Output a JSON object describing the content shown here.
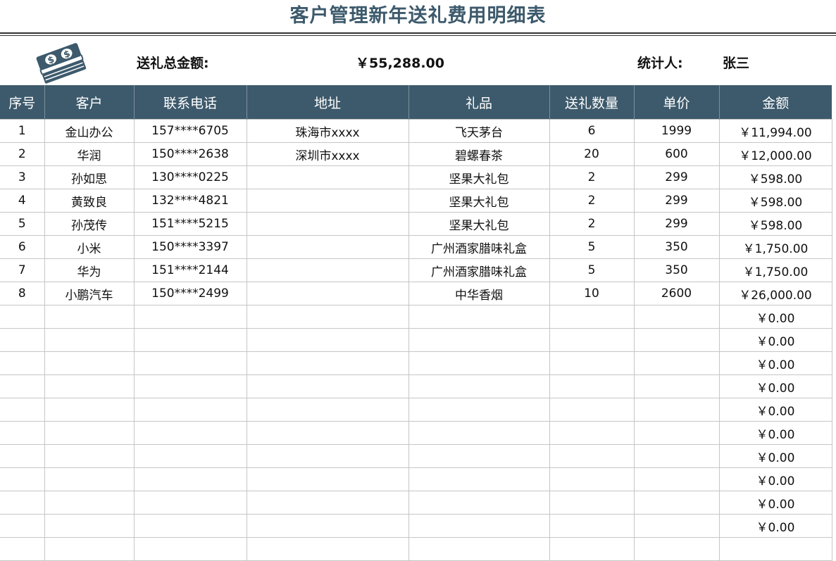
{
  "title": "客户管理新年送礼费用明细表",
  "summary": {
    "logo_icon": "money-stack-icon",
    "total_label": "送礼总金额:",
    "total_value": "￥55,288.00",
    "stat_label": "统计人:",
    "stat_value": "张三"
  },
  "colors": {
    "title": "#3d5a6c",
    "header_bg": "#3d5a6c",
    "header_text": "#ffffff",
    "grid": "#c6c6c6"
  },
  "table": {
    "headers": [
      "序号",
      "客户",
      "联系电话",
      "地址",
      "礼品",
      "送礼数量",
      "单价",
      "金额"
    ],
    "rows": [
      [
        "1",
        "金山办公",
        "157****6705",
        "珠海市xxxx",
        "飞天茅台",
        "6",
        "1999",
        "￥11,994.00"
      ],
      [
        "2",
        "华润",
        "150****2638",
        "深圳市xxxx",
        "碧螺春茶",
        "20",
        "600",
        "￥12,000.00"
      ],
      [
        "3",
        "孙如思",
        "130****0225",
        "",
        "坚果大礼包",
        "2",
        "299",
        "￥598.00"
      ],
      [
        "4",
        "黄致良",
        "132****4821",
        "",
        "坚果大礼包",
        "2",
        "299",
        "￥598.00"
      ],
      [
        "5",
        "孙茂传",
        "151****5215",
        "",
        "坚果大礼包",
        "2",
        "299",
        "￥598.00"
      ],
      [
        "6",
        "小米",
        "150****3397",
        "",
        "广州酒家腊味礼盒",
        "5",
        "350",
        "￥1,750.00"
      ],
      [
        "7",
        "华为",
        "151****2144",
        "",
        "广州酒家腊味礼盒",
        "5",
        "350",
        "￥1,750.00"
      ],
      [
        "8",
        "小鹏汽车",
        "150****2499",
        "",
        "中华香烟",
        "10",
        "2600",
        "￥26,000.00"
      ],
      [
        "",
        "",
        "",
        "",
        "",
        "",
        "",
        "￥0.00"
      ],
      [
        "",
        "",
        "",
        "",
        "",
        "",
        "",
        "￥0.00"
      ],
      [
        "",
        "",
        "",
        "",
        "",
        "",
        "",
        "￥0.00"
      ],
      [
        "",
        "",
        "",
        "",
        "",
        "",
        "",
        "￥0.00"
      ],
      [
        "",
        "",
        "",
        "",
        "",
        "",
        "",
        "￥0.00"
      ],
      [
        "",
        "",
        "",
        "",
        "",
        "",
        "",
        "￥0.00"
      ],
      [
        "",
        "",
        "",
        "",
        "",
        "",
        "",
        "￥0.00"
      ],
      [
        "",
        "",
        "",
        "",
        "",
        "",
        "",
        "￥0.00"
      ],
      [
        "",
        "",
        "",
        "",
        "",
        "",
        "",
        "￥0.00"
      ],
      [
        "",
        "",
        "",
        "",
        "",
        "",
        "",
        "￥0.00"
      ],
      [
        "",
        "",
        "",
        "",
        "",
        "",
        "",
        ""
      ]
    ]
  }
}
